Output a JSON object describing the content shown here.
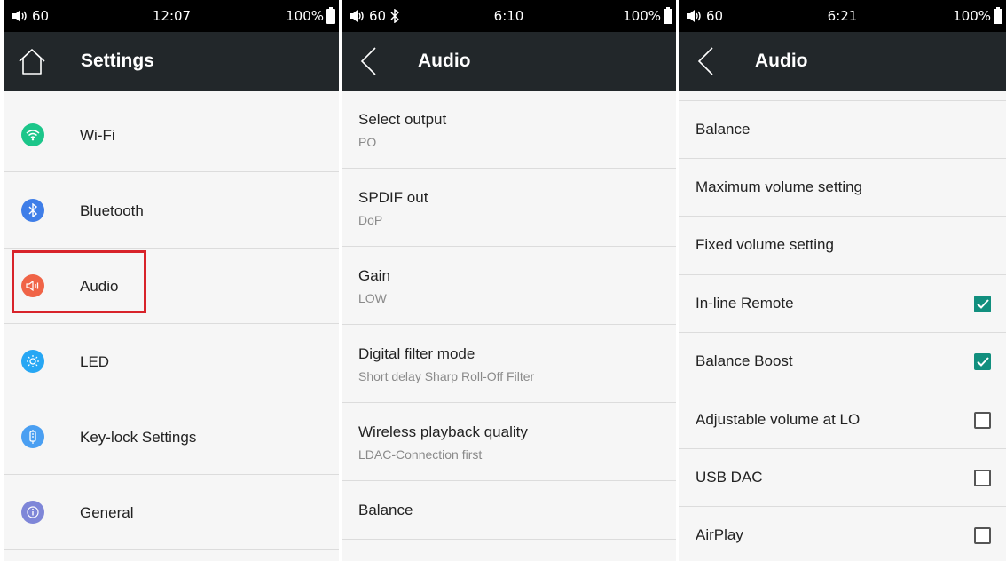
{
  "screens": {
    "settings": {
      "status": {
        "volume": "60",
        "time": "12:07",
        "battery": "100%"
      },
      "title": "Settings",
      "items": [
        {
          "label": "Wi-Fi",
          "color": "#1cc68a",
          "icon": "wifi-icon"
        },
        {
          "label": "Bluetooth",
          "color": "#3f7ee8",
          "icon": "bluetooth-icon"
        },
        {
          "label": "Audio",
          "color": "#f06447",
          "icon": "speaker-icon"
        },
        {
          "label": "LED",
          "color": "#27a7f4",
          "icon": "sun-icon"
        },
        {
          "label": "Key-lock Settings",
          "color": "#4a9ff2",
          "icon": "key-lock-icon"
        },
        {
          "label": "General",
          "color": "#7e86d8",
          "icon": "info-icon"
        }
      ]
    },
    "audio": {
      "status": {
        "volume": "60",
        "time": "6:10",
        "battery": "100%"
      },
      "title": "Audio",
      "items": [
        {
          "title": "Select output",
          "subtitle": "PO"
        },
        {
          "title": "SPDIF out",
          "subtitle": "DoP"
        },
        {
          "title": "Gain",
          "subtitle": "LOW"
        },
        {
          "title": "Digital filter mode",
          "subtitle": "Short delay Sharp Roll-Off Filter"
        },
        {
          "title": "Wireless playback quality",
          "subtitle": "LDAC-Connection first"
        },
        {
          "title": "Balance",
          "subtitle": ""
        }
      ]
    },
    "audio2": {
      "status": {
        "volume": "60",
        "time": "6:21",
        "battery": "100%"
      },
      "title": "Audio",
      "items": [
        {
          "title": "Balance",
          "checkbox": null
        },
        {
          "title": "Maximum volume setting",
          "checkbox": null
        },
        {
          "title": "Fixed volume setting",
          "checkbox": null
        },
        {
          "title": "In-line Remote",
          "checkbox": true
        },
        {
          "title": "Balance Boost",
          "checkbox": true
        },
        {
          "title": "Adjustable volume at LO",
          "checkbox": false
        },
        {
          "title": "USB DAC",
          "checkbox": false
        },
        {
          "title": "AirPlay",
          "checkbox": false
        }
      ]
    }
  },
  "colors": {
    "accent": "#118f7e",
    "highlight": "#d8232a",
    "titlebar": "#22272a"
  }
}
